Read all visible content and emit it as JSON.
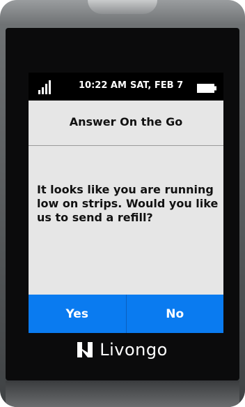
{
  "status_bar": {
    "signal_icon": "signal-bars-icon",
    "time": "10:22 AM",
    "date": "SAT, FEB 7",
    "battery_icon": "battery-icon"
  },
  "title": "Answer On the Go",
  "message": "It looks like you are running low on strips. Would you like us to send a refill?",
  "buttons": {
    "yes_label": "Yes",
    "no_label": "No"
  },
  "branding": {
    "logo_icon": "livongo-logo-icon",
    "logo_text": "Livongo"
  },
  "colors": {
    "button_blue": "#0a7bf0",
    "screen_background": "#e6e6e6",
    "status_bar_background": "#000000"
  }
}
